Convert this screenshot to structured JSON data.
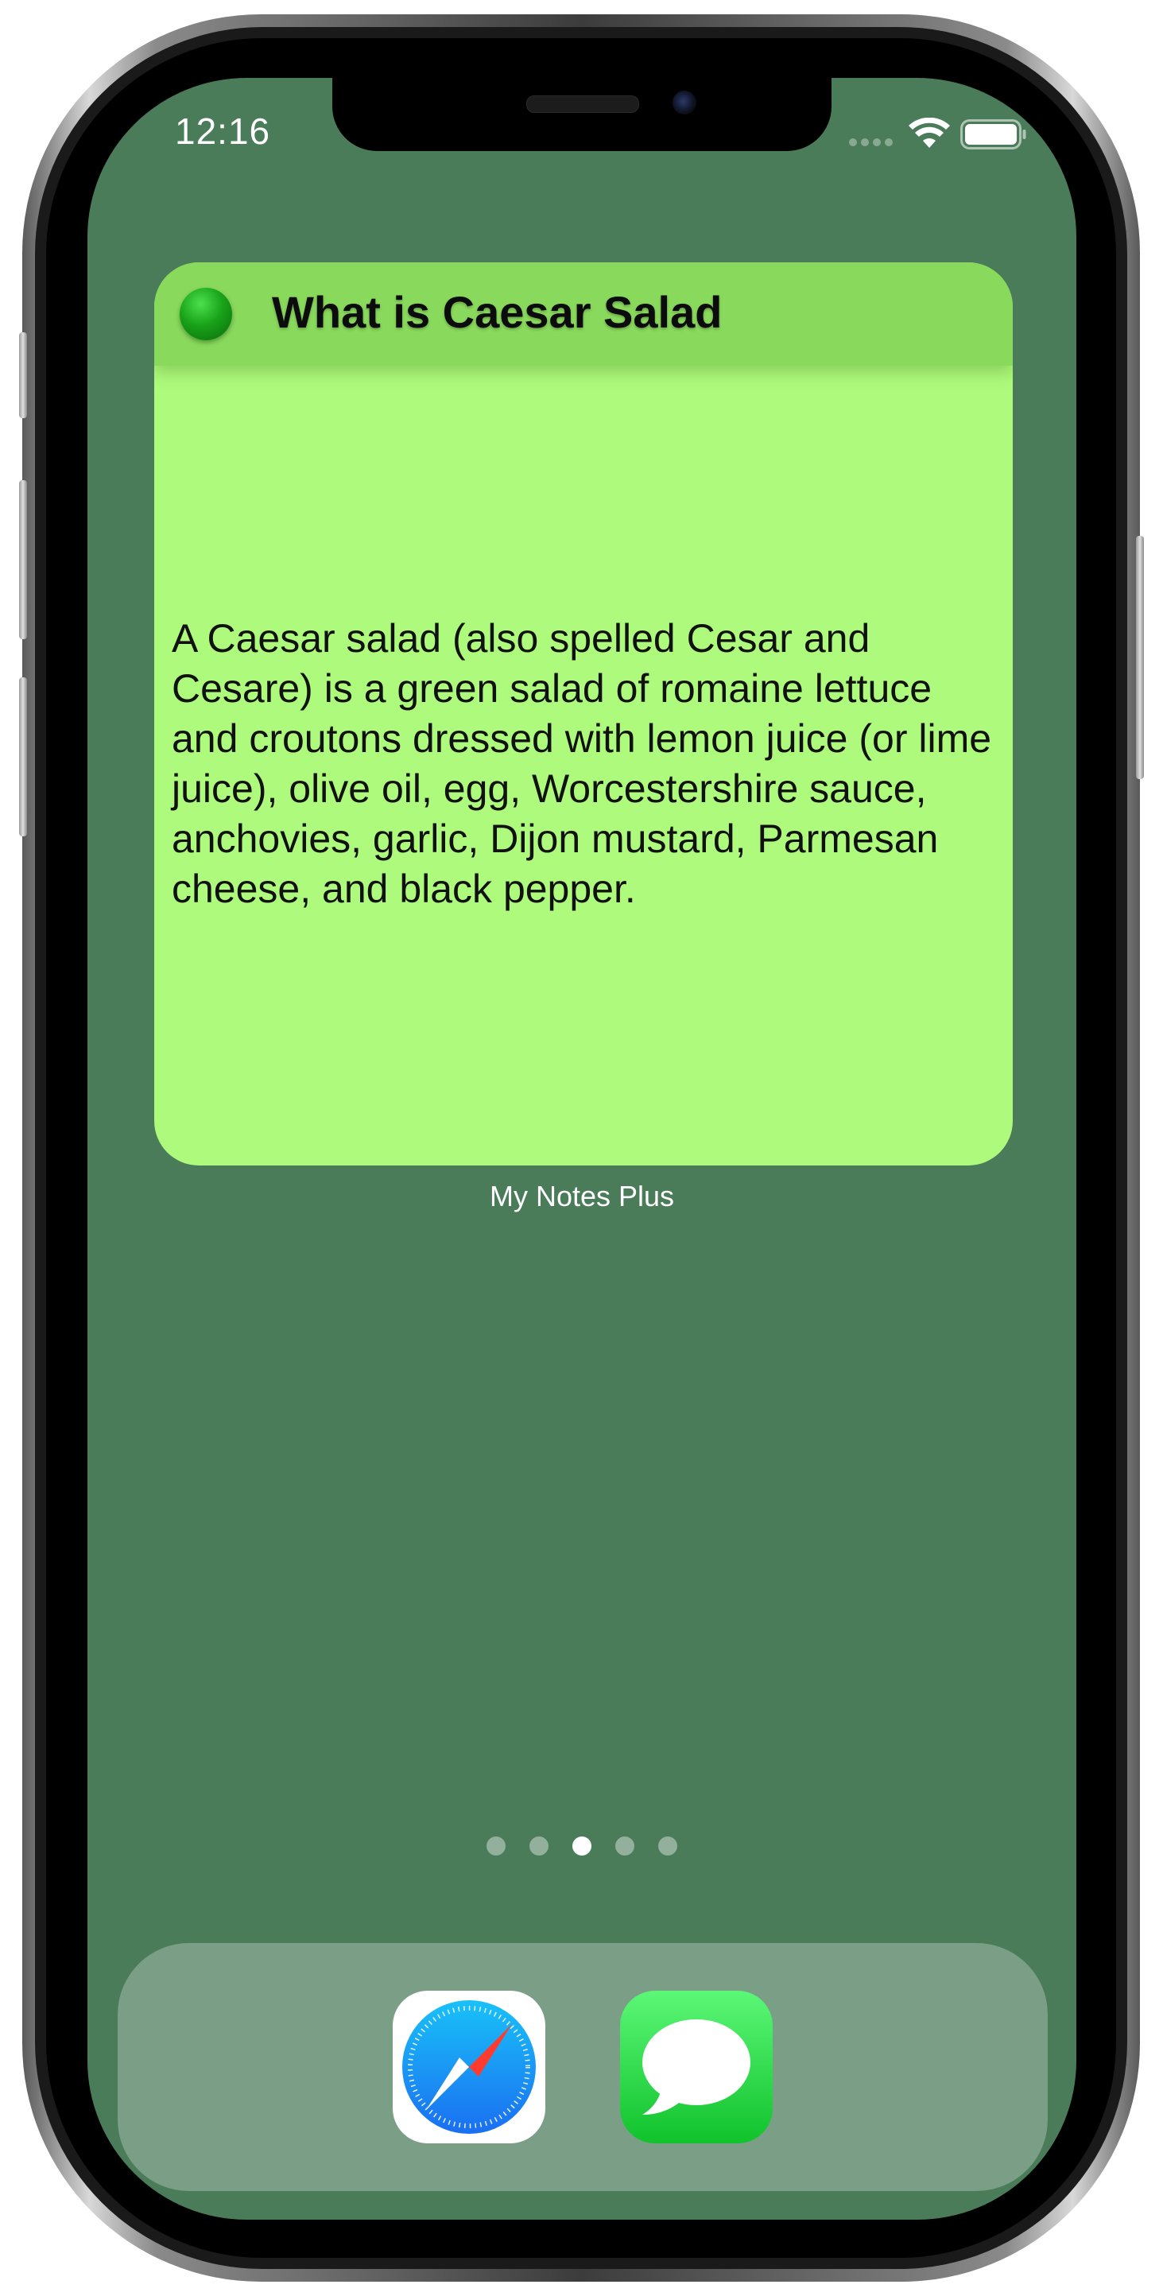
{
  "status_bar": {
    "time": "12:16",
    "wifi_icon": "wifi-icon",
    "battery_icon": "battery-icon"
  },
  "widget": {
    "status_icon": "green-dot-icon",
    "status_color": "#19a31a",
    "title": "What is Caesar Salad",
    "body": "A Caesar salad (also spelled Cesar and Cesare) is a green salad of romaine lettuce and croutons dressed with lemon juice (or lime juice), olive oil, egg, Worcestershire sauce, anchovies, garlic, Dijon mustard, Parmesan cheese, and black pepper.",
    "app_label": "My Notes Plus",
    "background_color": "#adfa7c",
    "header_color": "#89d95c"
  },
  "home_screen": {
    "wallpaper_color": "#4a7c5a",
    "page_count": 5,
    "active_page": 3
  },
  "dock": {
    "apps": [
      {
        "name": "Safari",
        "icon": "safari-icon"
      },
      {
        "name": "Messages",
        "icon": "messages-icon"
      }
    ]
  }
}
